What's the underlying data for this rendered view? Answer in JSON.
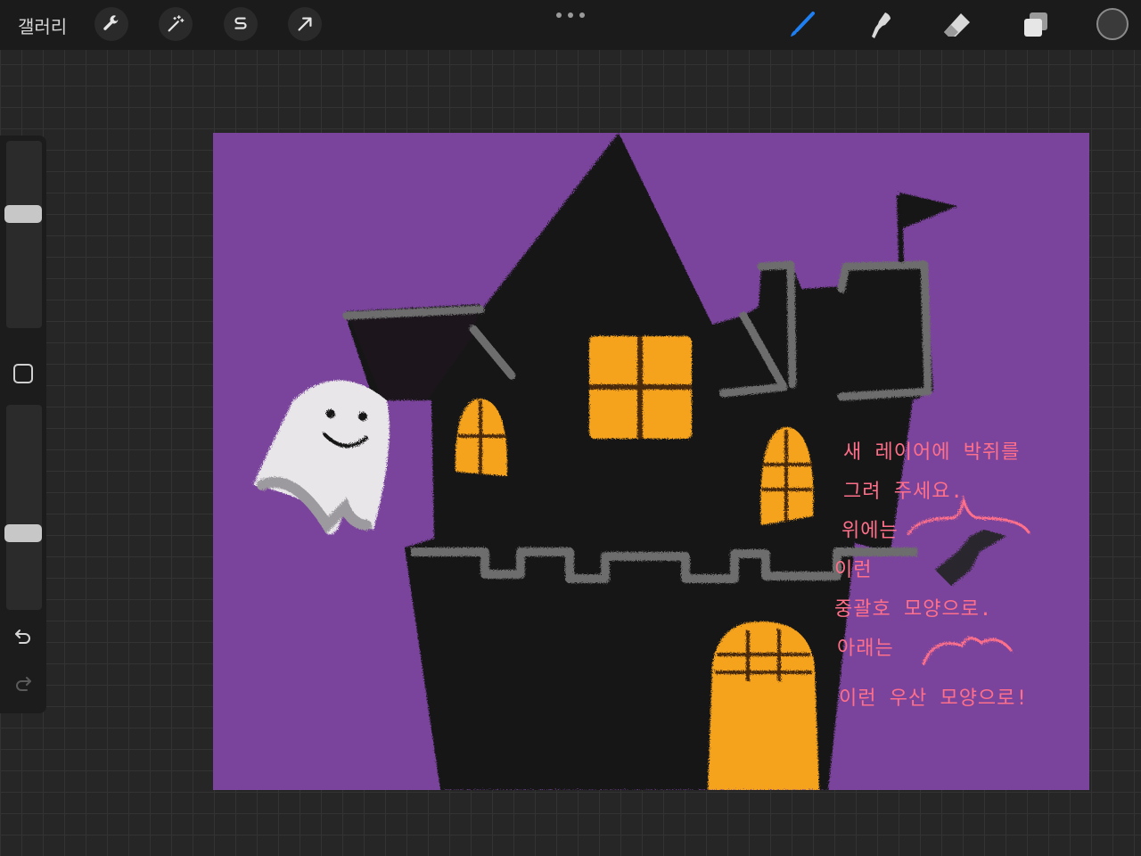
{
  "topbar": {
    "gallery_label": "갤러리",
    "left_tools": [
      "wrench-icon",
      "magic-wand-icon",
      "selection-s-icon",
      "transform-arrow-icon"
    ],
    "right_tools": [
      "brush-icon",
      "smudge-icon",
      "eraser-icon",
      "layers-icon"
    ],
    "accent_color": "#1e7ff2",
    "color_well": "#3a3a3a"
  },
  "sidebar": {
    "brush_size_level": 0.62,
    "opacity_level": 0.36
  },
  "canvas": {
    "background_color": "#7a449c",
    "notes": [
      "새 레이어에 박쥐를",
      "그려 주세요.",
      "위에는",
      "이런",
      "중괄호 모양으로.",
      "아래는",
      "이런 우산 모양으로!"
    ]
  }
}
